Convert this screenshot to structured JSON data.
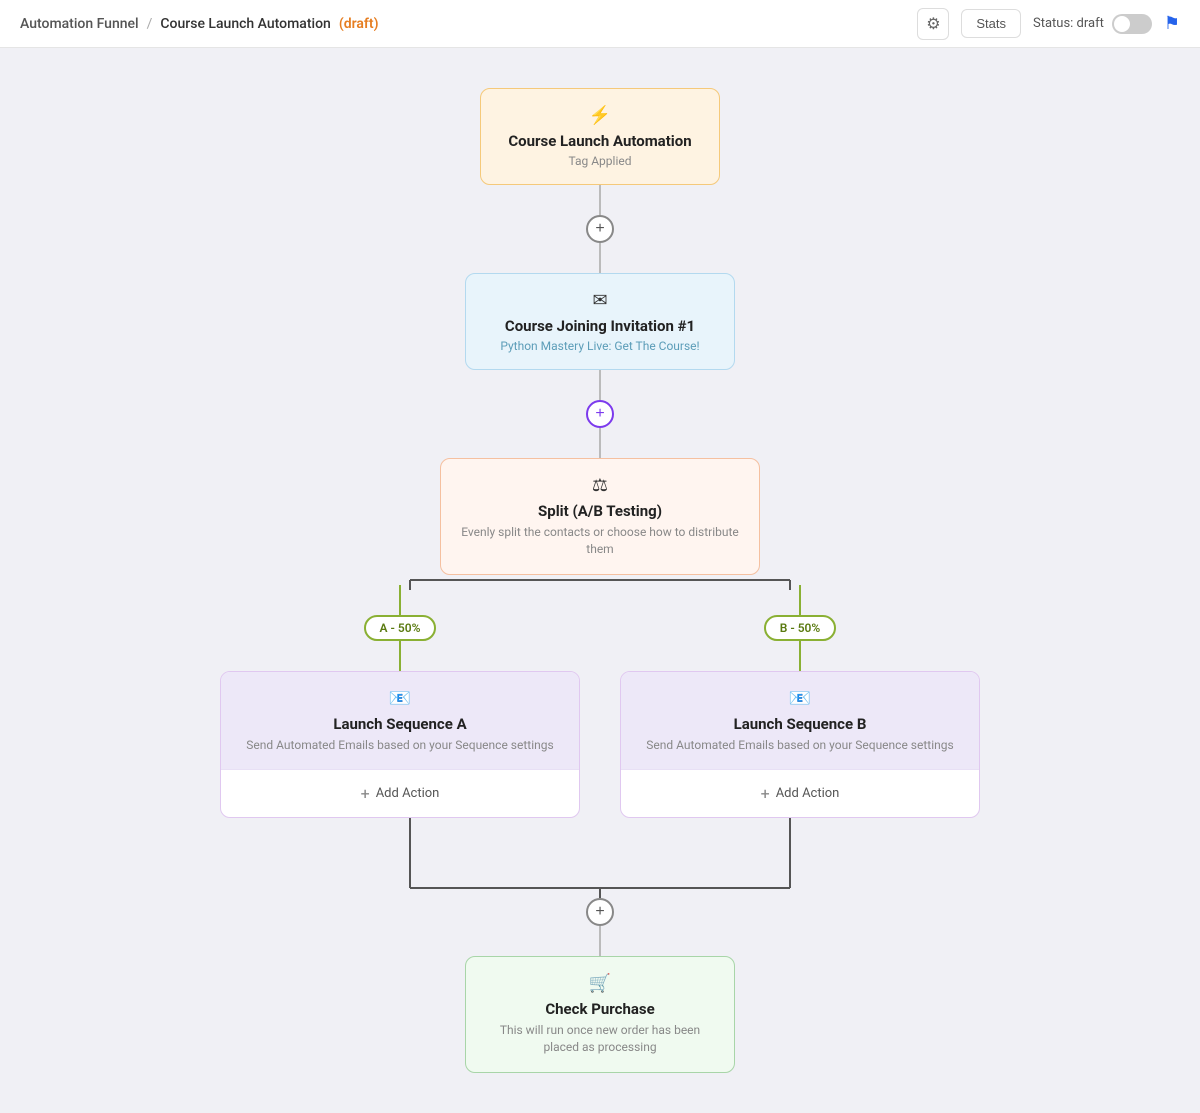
{
  "header": {
    "funnel_label": "Automation Funnel",
    "separator": "/",
    "page_name": "Course Launch Automation",
    "draft_label": "(draft)",
    "gear_icon": "⚙",
    "stats_label": "Stats",
    "status_label": "Status: draft",
    "flag_icon": "⚑"
  },
  "nodes": {
    "trigger": {
      "title": "Course Launch Automation",
      "subtitle": "Tag Applied"
    },
    "email": {
      "title": "Course Joining Invitation #1",
      "subtitle": "Python Mastery Live: Get The Course!"
    },
    "split": {
      "title": "Split (A/B Testing)",
      "subtitle": "Evenly split the contacts or choose how to distribute them"
    },
    "branch_a": {
      "label": "A - 50%",
      "seq_title": "Launch Sequence A",
      "seq_subtitle": "Send Automated Emails based on your Sequence settings",
      "add_action": "Add Action"
    },
    "branch_b": {
      "label": "B - 50%",
      "seq_title": "Launch Sequence B",
      "seq_subtitle": "Send Automated Emails based on your Sequence settings",
      "add_action": "Add Action"
    },
    "check": {
      "title": "Check Purchase",
      "subtitle": "This will run once new order has been placed as processing"
    }
  }
}
